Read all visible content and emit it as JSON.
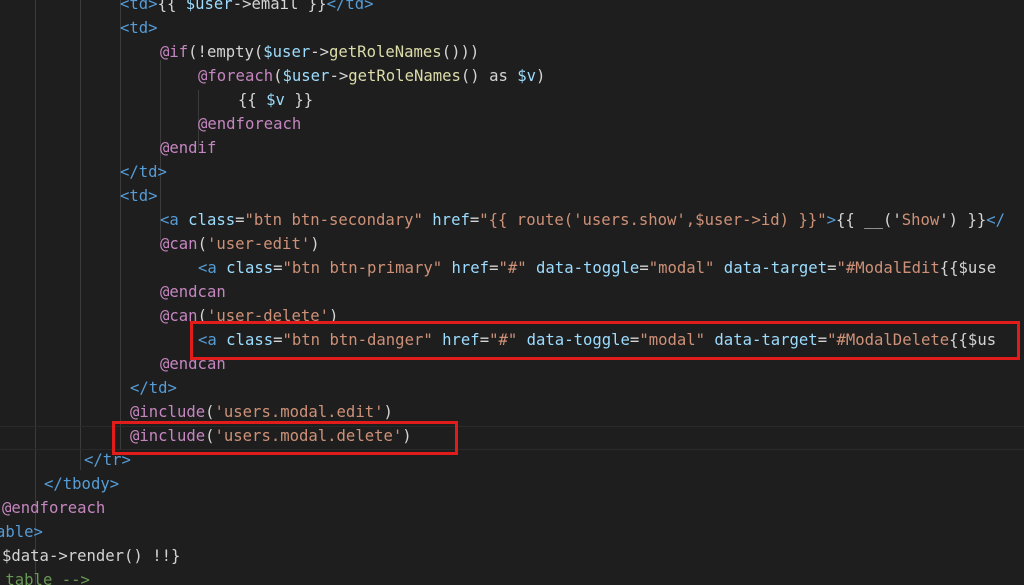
{
  "editor": {
    "highlight_color": "#e21b1b",
    "lines": [
      [
        [
          "tag",
          "<td>"
        ],
        [
          "plain",
          "{{ "
        ],
        [
          "var",
          "$user"
        ],
        [
          "plain",
          "->email }}"
        ],
        [
          "tag",
          "</td>"
        ]
      ],
      [
        [
          "tag",
          "<td>"
        ]
      ],
      [
        [
          "dir",
          "@if"
        ],
        [
          "plain",
          "(!empty("
        ],
        [
          "var",
          "$user"
        ],
        [
          "plain",
          "->"
        ],
        [
          "fn",
          "getRoleNames"
        ],
        [
          "plain",
          "()))"
        ]
      ],
      [
        [
          "dir",
          "@foreach"
        ],
        [
          "plain",
          "("
        ],
        [
          "var",
          "$user"
        ],
        [
          "plain",
          "->"
        ],
        [
          "fn",
          "getRoleNames"
        ],
        [
          "plain",
          "() as "
        ],
        [
          "var",
          "$v"
        ],
        [
          "plain",
          ")"
        ]
      ],
      [
        [
          "plain",
          "{{ "
        ],
        [
          "var",
          "$v"
        ],
        [
          "plain",
          " }}"
        ]
      ],
      [
        [
          "dir",
          "@endforeach"
        ]
      ],
      [
        [
          "dir",
          "@endif"
        ]
      ],
      [
        [
          "tag",
          "</td>"
        ]
      ],
      [
        [
          "tag",
          "<td>"
        ]
      ],
      [
        [
          "tag",
          "<a "
        ],
        [
          "attr",
          "class"
        ],
        [
          "plain",
          "="
        ],
        [
          "str",
          "\"btn btn-secondary\""
        ],
        [
          "attr",
          " href"
        ],
        [
          "plain",
          "="
        ],
        [
          "str",
          "\"{{ route('users.show',$user->id) }}\""
        ],
        [
          "tag",
          ">"
        ],
        [
          "plain",
          "{{ __('"
        ],
        [
          "str",
          "Show"
        ],
        [
          "plain",
          "') }}"
        ],
        [
          "tag",
          "</"
        ]
      ],
      [
        [
          "dir",
          "@can"
        ],
        [
          "plain",
          "("
        ],
        [
          "str",
          "'user-edit'"
        ],
        [
          "plain",
          ")"
        ]
      ],
      [
        [
          "tag",
          "<a "
        ],
        [
          "attr",
          "class"
        ],
        [
          "plain",
          "="
        ],
        [
          "str",
          "\"btn btn-primary\""
        ],
        [
          "attr",
          " href"
        ],
        [
          "plain",
          "="
        ],
        [
          "str",
          "\"#\""
        ],
        [
          "attr",
          " data-toggle"
        ],
        [
          "plain",
          "="
        ],
        [
          "str",
          "\"modal\""
        ],
        [
          "attr",
          " data-target"
        ],
        [
          "plain",
          "="
        ],
        [
          "str",
          "\"#ModalEdit"
        ],
        [
          "plain",
          "{{$use"
        ]
      ],
      [
        [
          "dir",
          "@endcan"
        ]
      ],
      [
        [
          "dir",
          "@can"
        ],
        [
          "plain",
          "("
        ],
        [
          "str",
          "'user-delete'"
        ],
        [
          "plain",
          ")"
        ]
      ],
      [
        [
          "tag",
          "<a "
        ],
        [
          "attr",
          "class"
        ],
        [
          "plain",
          "="
        ],
        [
          "str",
          "\"btn btn-danger\""
        ],
        [
          "attr",
          " href"
        ],
        [
          "plain",
          "="
        ],
        [
          "str",
          "\"#\""
        ],
        [
          "attr",
          " data-toggle"
        ],
        [
          "plain",
          "="
        ],
        [
          "str",
          "\"modal\""
        ],
        [
          "attr",
          " data-target"
        ],
        [
          "plain",
          "="
        ],
        [
          "str",
          "\"#ModalDelete"
        ],
        [
          "plain",
          "{{$us"
        ]
      ],
      [
        [
          "dir",
          "@endcan"
        ]
      ],
      [
        [
          "tag",
          "</td>"
        ]
      ],
      [
        [
          "dir",
          "@include"
        ],
        [
          "plain",
          "("
        ],
        [
          "str",
          "'users.modal.edit'"
        ],
        [
          "plain",
          ")"
        ]
      ],
      [
        [
          "dir",
          "@include"
        ],
        [
          "plain",
          "("
        ],
        [
          "str",
          "'users.modal.delete'"
        ],
        [
          "plain",
          ")"
        ]
      ],
      [
        [
          "tag",
          "</tr>"
        ]
      ],
      [
        [
          "tag",
          "</tbody>"
        ]
      ],
      [
        [
          "dir",
          "@endforeach"
        ]
      ],
      [
        [
          "tag",
          "able>"
        ]
      ],
      [
        [
          "plain",
          "$data->render() !!}"
        ]
      ],
      [
        [
          "cmt",
          "_table -->"
        ]
      ]
    ]
  }
}
